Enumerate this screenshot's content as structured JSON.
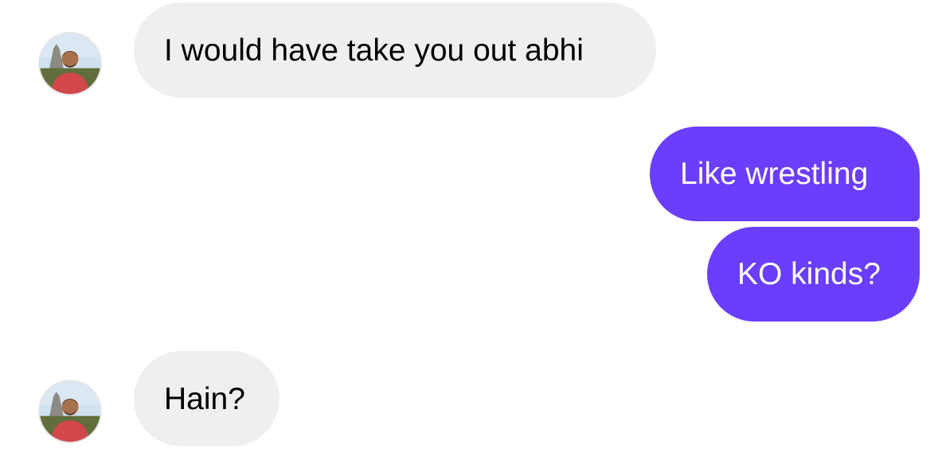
{
  "colors": {
    "incoming_bubble": "#efefef",
    "outgoing_bubble": "#6a3efc",
    "incoming_text": "#000000",
    "outgoing_text": "#ffffff"
  },
  "messages": [
    {
      "sender": "other",
      "text": "I would have take you out abhi"
    },
    {
      "sender": "self",
      "text": "Like wrestling"
    },
    {
      "sender": "self",
      "text": "KO kinds?"
    },
    {
      "sender": "other",
      "text": "Hain?"
    }
  ]
}
